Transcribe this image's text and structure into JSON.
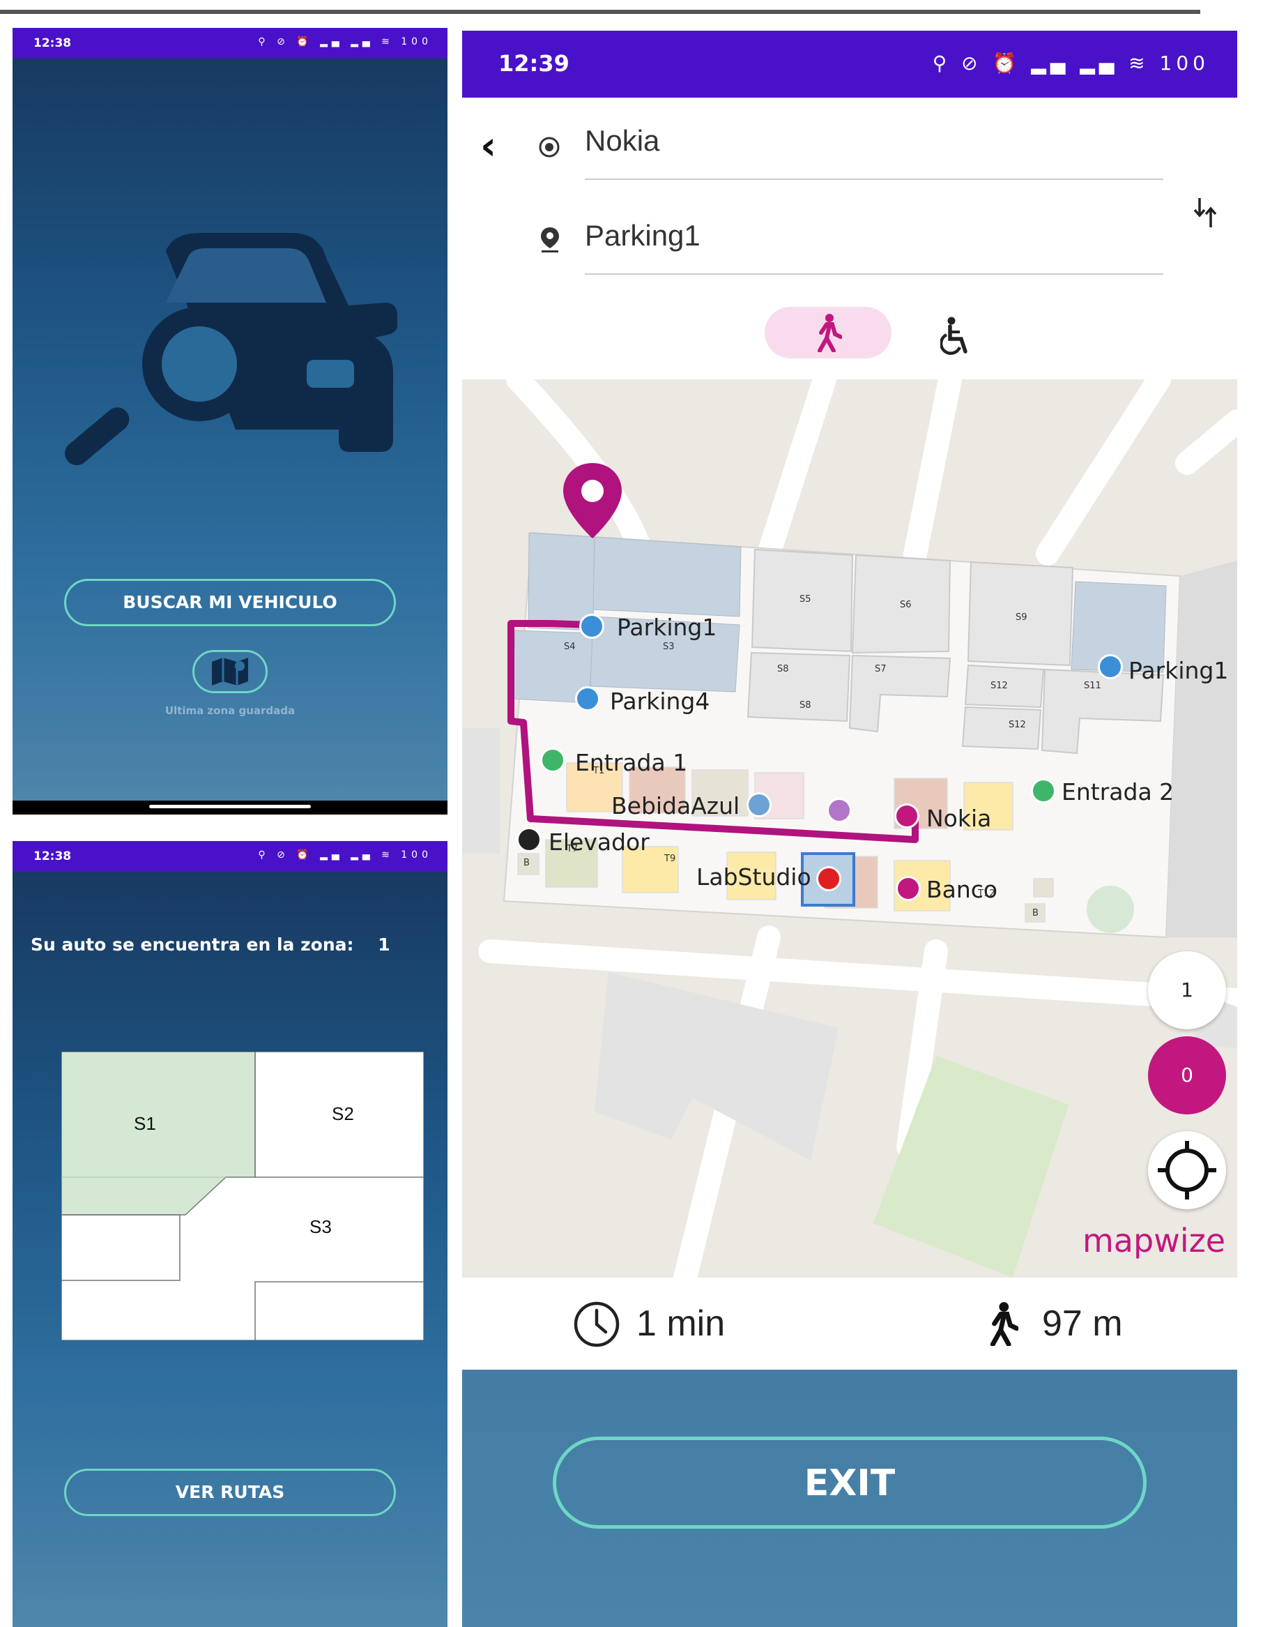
{
  "phone1": {
    "time": "12:38",
    "status_icons": "⚲ ⊘ ⏰ ▂▄ ▂▄ ≋ 100",
    "search_button": "BUSCAR MI VEHICULO",
    "last_zone_label": "Ultima zona guardada",
    "icons": {
      "car": "car-search-icon",
      "map": "map-icon"
    }
  },
  "phone2": {
    "time": "12:38",
    "status_icons": "⚲ ⊘ ⏰ ▂▄ ▂▄ ≋ 100",
    "zone_text": "Su auto se encuentra en la zona:",
    "zone_number": "1",
    "slots": [
      "S1",
      "S2",
      "S3"
    ],
    "routes_button": "VER RUTAS",
    "colors": {
      "selected_zone": "#d4e8d4"
    }
  },
  "phone3": {
    "time": "12:39",
    "status_icons": "⚲ ⊘ ⏰ ▂▄ ▂▄ ≋ 100",
    "from_value": "Nokia",
    "to_value": "Parking1",
    "swap_icon": "swap-icon",
    "mode_walk_icon": "walk-icon",
    "mode_accessible_icon": "wheelchair-icon",
    "map": {
      "labels": {
        "parking1": "Parking1",
        "parking1_right": "Parking1",
        "parking4": "Parking4",
        "entrada1": "Entrada 1",
        "entrada2": "Entrada 2",
        "bebida": "BebidaAzul",
        "nokia": "Nokia",
        "elevador": "Elevador",
        "labstudio": "LabStudio",
        "banco": "Banco"
      },
      "slots": [
        "S5",
        "S6",
        "S9",
        "S4",
        "S3",
        "S8",
        "S7",
        "S8",
        "S12",
        "S11",
        "S12",
        "T1",
        "T7",
        "T9",
        "B",
        "B",
        "T12"
      ],
      "floor_buttons": [
        "1",
        "0"
      ],
      "brand": "mapwize",
      "colors": {
        "route": "#b0127e",
        "accent": "#c2177f"
      }
    },
    "duration": "1 min",
    "distance": "97 m",
    "exit_button": "EXIT"
  }
}
